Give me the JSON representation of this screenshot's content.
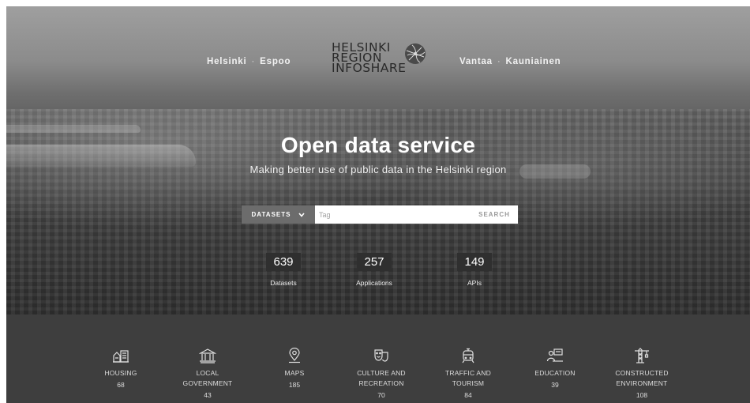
{
  "header": {
    "nav_left": [
      "Helsinki",
      "Espoo"
    ],
    "nav_right": [
      "Vantaa",
      "Kauniainen"
    ],
    "separator": "·",
    "logo_lines": [
      "HELSINKI",
      "REGION",
      "INFOSHARE"
    ]
  },
  "hero": {
    "title": "Open data service",
    "subtitle": "Making better use of public data in the Helsinki region"
  },
  "search": {
    "dropdown_label": "DATASETS",
    "placeholder": "Tag",
    "button_label": "SEARCH"
  },
  "stats": [
    {
      "value": "639",
      "label": "Datasets"
    },
    {
      "value": "257",
      "label": "Applications"
    },
    {
      "value": "149",
      "label": "APIs"
    }
  ],
  "categories": [
    {
      "icon": "housing-icon",
      "label_lines": [
        "HOUSING"
      ],
      "count": "68"
    },
    {
      "icon": "government-icon",
      "label_lines": [
        "LOCAL",
        "GOVERNMENT"
      ],
      "count": "43"
    },
    {
      "icon": "map-pin-icon",
      "label_lines": [
        "MAPS"
      ],
      "count": "185"
    },
    {
      "icon": "theater-masks-icon",
      "label_lines": [
        "CULTURE AND",
        "RECREATION"
      ],
      "count": "70"
    },
    {
      "icon": "tram-icon",
      "label_lines": [
        "TRAFFIC AND",
        "TOURISM"
      ],
      "count": "84"
    },
    {
      "icon": "education-icon",
      "label_lines": [
        "EDUCATION"
      ],
      "count": "39"
    },
    {
      "icon": "crane-icon",
      "label_lines": [
        "CONSTRUCTED",
        "ENVIRONMENT"
      ],
      "count": "108"
    }
  ]
}
